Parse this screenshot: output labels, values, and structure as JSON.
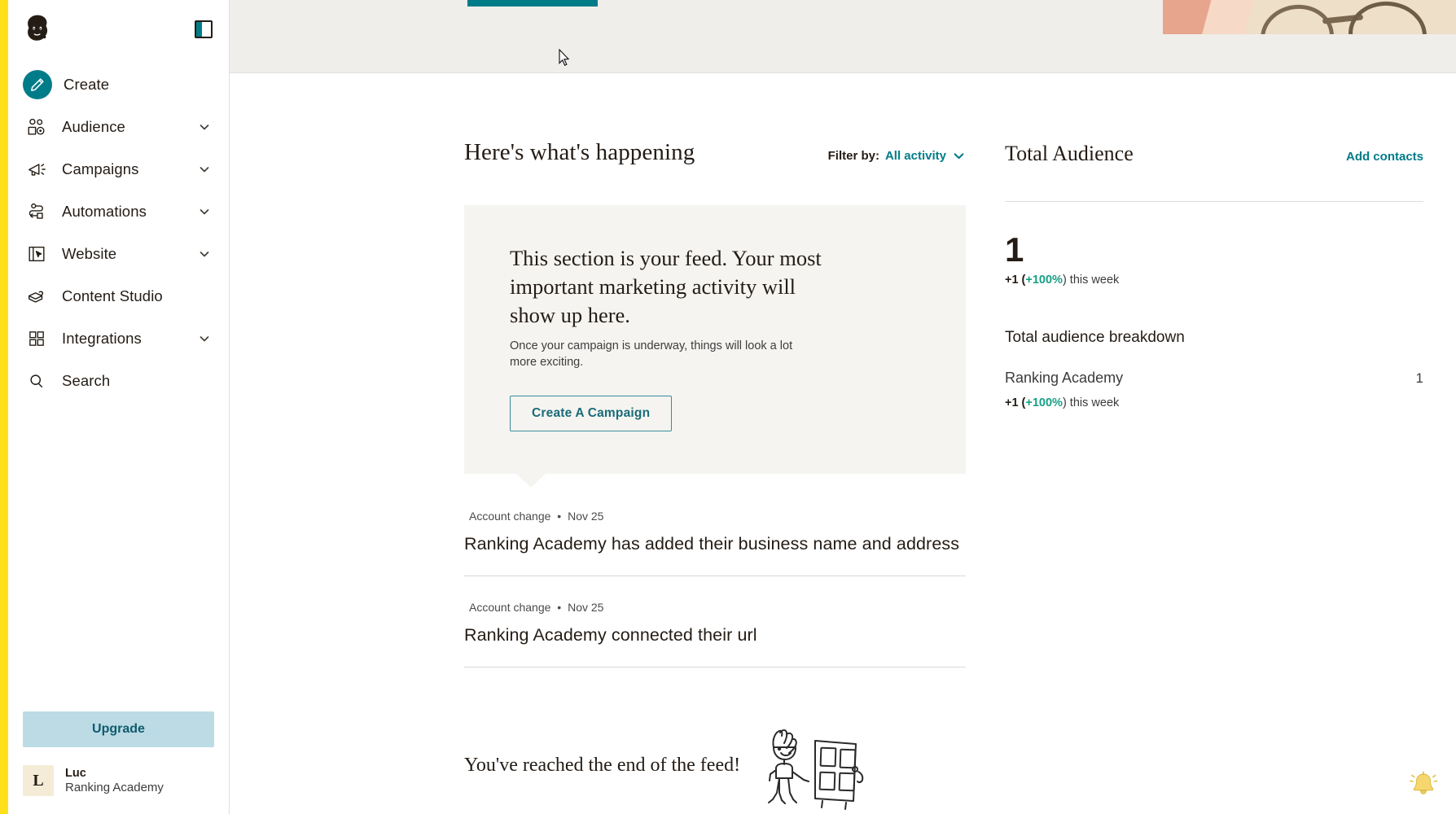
{
  "sidebar": {
    "logo_name": "mailchimp-freddie-logo",
    "panel_toggle_name": "collapse-panel-icon",
    "items": [
      {
        "label": "Create",
        "icon": "pencil-icon",
        "expandable": false
      },
      {
        "label": "Audience",
        "icon": "audience-icon",
        "expandable": true
      },
      {
        "label": "Campaigns",
        "icon": "megaphone-icon",
        "expandable": true
      },
      {
        "label": "Automations",
        "icon": "automation-icon",
        "expandable": true
      },
      {
        "label": "Website",
        "icon": "website-icon",
        "expandable": true
      },
      {
        "label": "Content Studio",
        "icon": "content-icon",
        "expandable": false
      },
      {
        "label": "Integrations",
        "icon": "grid-icon",
        "expandable": true
      },
      {
        "label": "Search",
        "icon": "search-icon",
        "expandable": false
      }
    ],
    "upgrade_label": "Upgrade",
    "account": {
      "avatar_initial": "L",
      "name": "Luc",
      "org": "Ranking Academy"
    }
  },
  "feed": {
    "title": "Here's what's happening",
    "filter": {
      "label": "Filter by:",
      "value": "All activity",
      "chevron": "chevron-down-icon"
    },
    "promo_card": {
      "heading": "This section is your feed. Your most important marketing activity will show up here.",
      "subtext": "Once your campaign is underway, things will look a lot more exciting.",
      "cta_label": "Create A Campaign"
    },
    "items": [
      {
        "category": "Account change",
        "separator": "•",
        "date": "Nov 25",
        "headline": "Ranking Academy has added their business name and address"
      },
      {
        "category": "Account change",
        "separator": "•",
        "date": "Nov 25",
        "headline": "Ranking Academy connected their url"
      }
    ],
    "end_text": "You've reached the end of the feed!",
    "end_illustration": "person-with-door-doodle"
  },
  "aside": {
    "title": "Total Audience",
    "add_contacts_label": "Add contacts",
    "total": "1",
    "total_delta_prefix": "+1 (",
    "total_delta_pct": "+100%",
    "total_delta_suffix": ") this week",
    "breakdown_title": "Total audience breakdown",
    "breakdown": [
      {
        "name": "Ranking Academy",
        "count": "1",
        "delta_prefix": "+1 (",
        "delta_pct": "+100%",
        "delta_suffix": ") this week"
      }
    ]
  },
  "misc": {
    "bell_icon": "notification-bell-icon",
    "cursor_icon": "mouse-cursor"
  },
  "colors": {
    "brand_yellow": "#ffe01b",
    "teal": "#007c89",
    "upgrade_bg": "#bcdbe5",
    "green": "#16a085",
    "ink": "#241c15",
    "card_bg": "#f5f4f1",
    "banner_bg": "#efeeea"
  }
}
